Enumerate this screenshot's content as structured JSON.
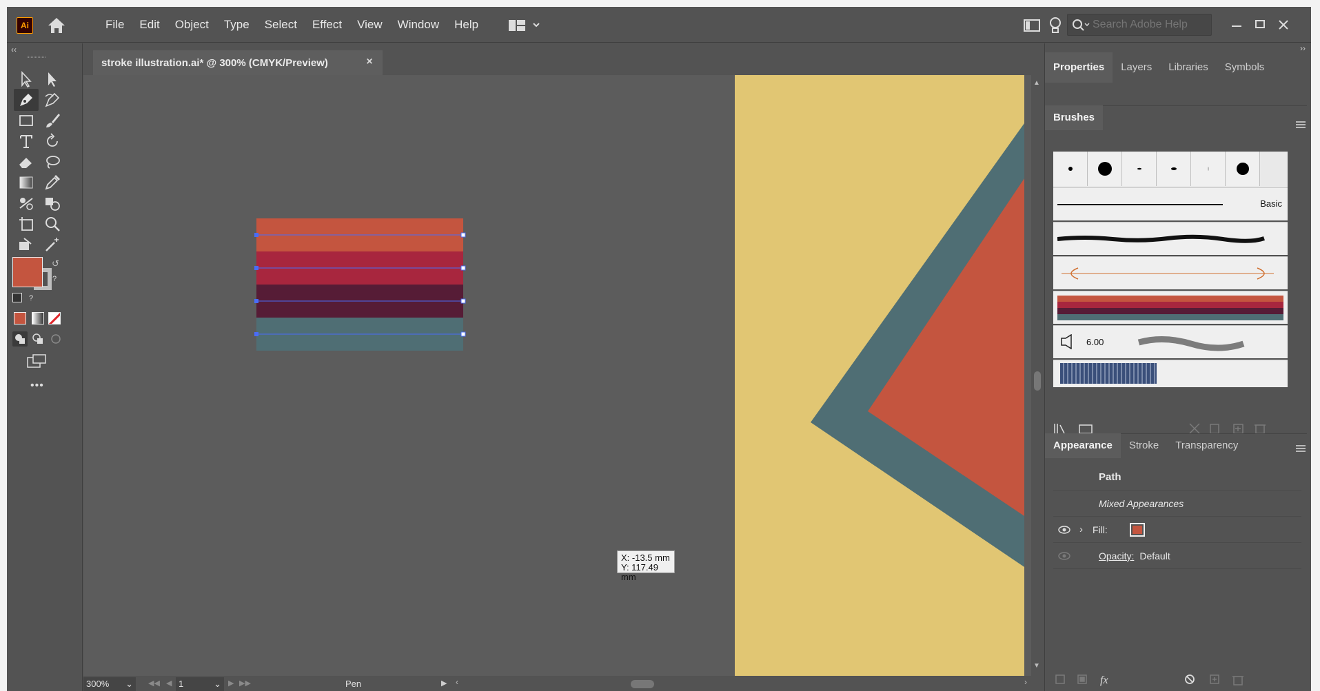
{
  "app": {
    "logo_text": "Ai",
    "menu": [
      "File",
      "Edit",
      "Object",
      "Type",
      "Select",
      "Effect",
      "View",
      "Window",
      "Help"
    ],
    "search_placeholder": "Search Adobe Help"
  },
  "document": {
    "tab_title": "stroke illustration.ai* @ 300% (CMYK/Preview)",
    "close_glyph": "×"
  },
  "canvas": {
    "stripe_colors": [
      "#c4553f",
      "#a8263e",
      "#561c36",
      "#4f6e74"
    ],
    "artboard_color": "#e1c673",
    "shape_colors": {
      "outer": "#4f6e74",
      "inner": "#c4553f"
    },
    "coord_tip": {
      "x": "X: -13.5 mm",
      "y": "Y: 117.49 mm"
    }
  },
  "status": {
    "zoom": "300%",
    "artboard_number": "1",
    "current_tool": "Pen"
  },
  "tools": {
    "fill_color": "#c4553f",
    "more_glyph": "•••"
  },
  "panels": {
    "top_tabs": [
      "Properties",
      "Layers",
      "Libraries",
      "Symbols"
    ],
    "brushes_tab": "Brushes",
    "brush_basic_label": "Basic",
    "brush_size_label": "6.00",
    "bottom_tabs": [
      "Appearance",
      "Stroke",
      "Transparency"
    ],
    "appearance": {
      "path": "Path",
      "mixed": "Mixed Appearances",
      "fill_label": "Fill:",
      "opacity_label": "Opacity:",
      "opacity_value": "Default"
    }
  }
}
